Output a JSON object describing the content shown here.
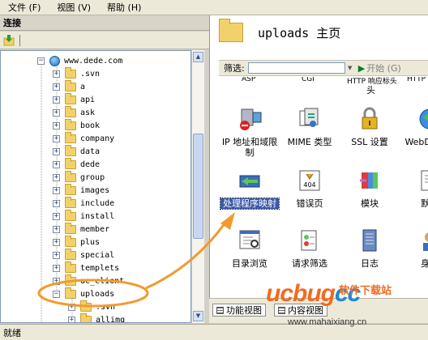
{
  "menu": {
    "file": "文件 (F)",
    "view": "视图 (V)",
    "help": "帮助 (H)"
  },
  "left_panel": {
    "title": "连接",
    "tree": {
      "root": "www.dede.com",
      "children": [
        ".svn",
        "a",
        "api",
        "ask",
        "book",
        "company",
        "data",
        "dede",
        "group",
        "images",
        "include",
        "install",
        "member",
        "plus",
        "special",
        "templets",
        "uc_client",
        "uploads"
      ],
      "uploads_children": [
        ".svn",
        "allimg"
      ]
    }
  },
  "right_panel": {
    "title": "uploads 主页",
    "filter": {
      "label": "筛选:",
      "start": "开始 (G)"
    },
    "cut_labels": [
      "ASP",
      "CGI",
      "HTTP 响应标头",
      "HTTP"
    ],
    "cut_label_tail": "头",
    "icons": [
      {
        "name": "ip-restrict-icon",
        "label": "IP 地址和域限制"
      },
      {
        "name": "mime-icon",
        "label": "MIME 类型"
      },
      {
        "name": "ssl-icon",
        "label": "SSL 设置"
      },
      {
        "name": "webdav-icon",
        "label": "WebDAV 规"
      },
      {
        "name": "handler-mapping-icon",
        "label": "处理程序映射"
      },
      {
        "name": "error-pages-icon",
        "label": "错误页"
      },
      {
        "name": "modules-icon",
        "label": "模块"
      },
      {
        "name": "default-doc-icon",
        "label": "默认"
      },
      {
        "name": "dir-browse-icon",
        "label": "目录浏览"
      },
      {
        "name": "request-filter-icon",
        "label": "请求筛选"
      },
      {
        "name": "logging-icon",
        "label": "日志"
      },
      {
        "name": "auth-icon",
        "label": "身份"
      }
    ],
    "tabs": {
      "features": "功能视图",
      "content": "内容视图"
    }
  },
  "status": {
    "text": "就绪"
  },
  "watermark": {
    "logo": "ucbug",
    "logo_suffix": "cc",
    "site_name": "软件下载站",
    "url": "www.mahaixiang.cn"
  },
  "colors": {
    "highlight": "#3b5aa8",
    "arrow": "#f39a2c",
    "watermark_orange": "#f36a1d"
  }
}
